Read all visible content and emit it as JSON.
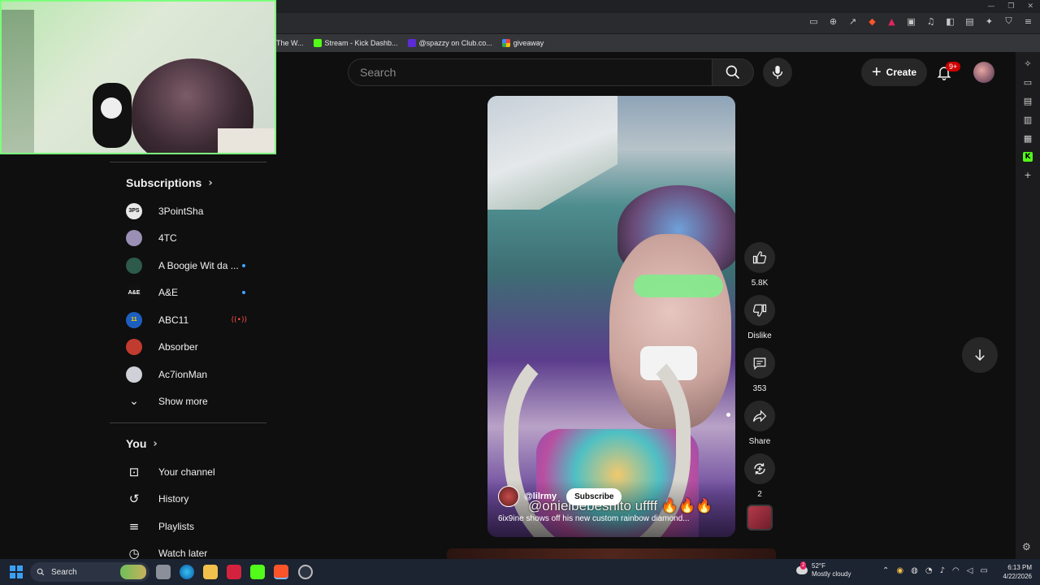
{
  "browser": {
    "window_controls": [
      "—",
      "❐",
      "✕"
    ],
    "bookmarks": [
      {
        "label": "The W...",
        "color": "#555555"
      },
      {
        "label": "Stream - Kick Dashb...",
        "color": "#53fc18"
      },
      {
        "label": "@spazzy on Club.co...",
        "color": "#5b2bd6"
      },
      {
        "label": "giveaway",
        "color": "#4285f4"
      }
    ]
  },
  "header": {
    "search_placeholder": "Search",
    "create_label": "Create",
    "notification_count": "9+"
  },
  "sidebar": {
    "subscriptions_title": "Subscriptions",
    "subscriptions": [
      {
        "name": "3PointSha",
        "avatar_color": "#e8e8e8",
        "indicator": ""
      },
      {
        "name": "4TC",
        "avatar_color": "#9b8fb5",
        "indicator": ""
      },
      {
        "name": "A Boogie Wit da ...",
        "avatar_color": "#2d5a4a",
        "indicator": "new"
      },
      {
        "name": "A&E",
        "avatar_color": "#111111",
        "indicator": "new"
      },
      {
        "name": "ABC11",
        "avatar_color": "#1d5fbf",
        "indicator": "live"
      },
      {
        "name": "Absorber",
        "avatar_color": "#c23b2f",
        "indicator": ""
      },
      {
        "name": "Ac7ionMan",
        "avatar_color": "#d0d0d8",
        "indicator": ""
      }
    ],
    "show_more": "Show more",
    "you_title": "You",
    "you_items": [
      {
        "label": "Your channel",
        "icon": "person-box-icon"
      },
      {
        "label": "History",
        "icon": "history-icon"
      },
      {
        "label": "Playlists",
        "icon": "playlists-icon"
      },
      {
        "label": "Watch later",
        "icon": "clock-icon"
      }
    ]
  },
  "video": {
    "channel_handle": "@lilrmy",
    "subscribe_label": "Subscribe",
    "overlay_text": "@onielbebeshito uffff 🔥🔥🔥",
    "title": "6ix9ine shows off his new custom rainbow diamond..."
  },
  "actions": {
    "like_count": "5.8K",
    "dislike_label": "Dislike",
    "comment_count": "353",
    "share_label": "Share",
    "remix_count": "2"
  },
  "taskbar": {
    "search_label": "Search",
    "weather_temp": "52°F",
    "weather_desc": "Mostly cloudy",
    "weather_badge": "2",
    "time": "6:13 PM",
    "date": "4/22/2026"
  }
}
